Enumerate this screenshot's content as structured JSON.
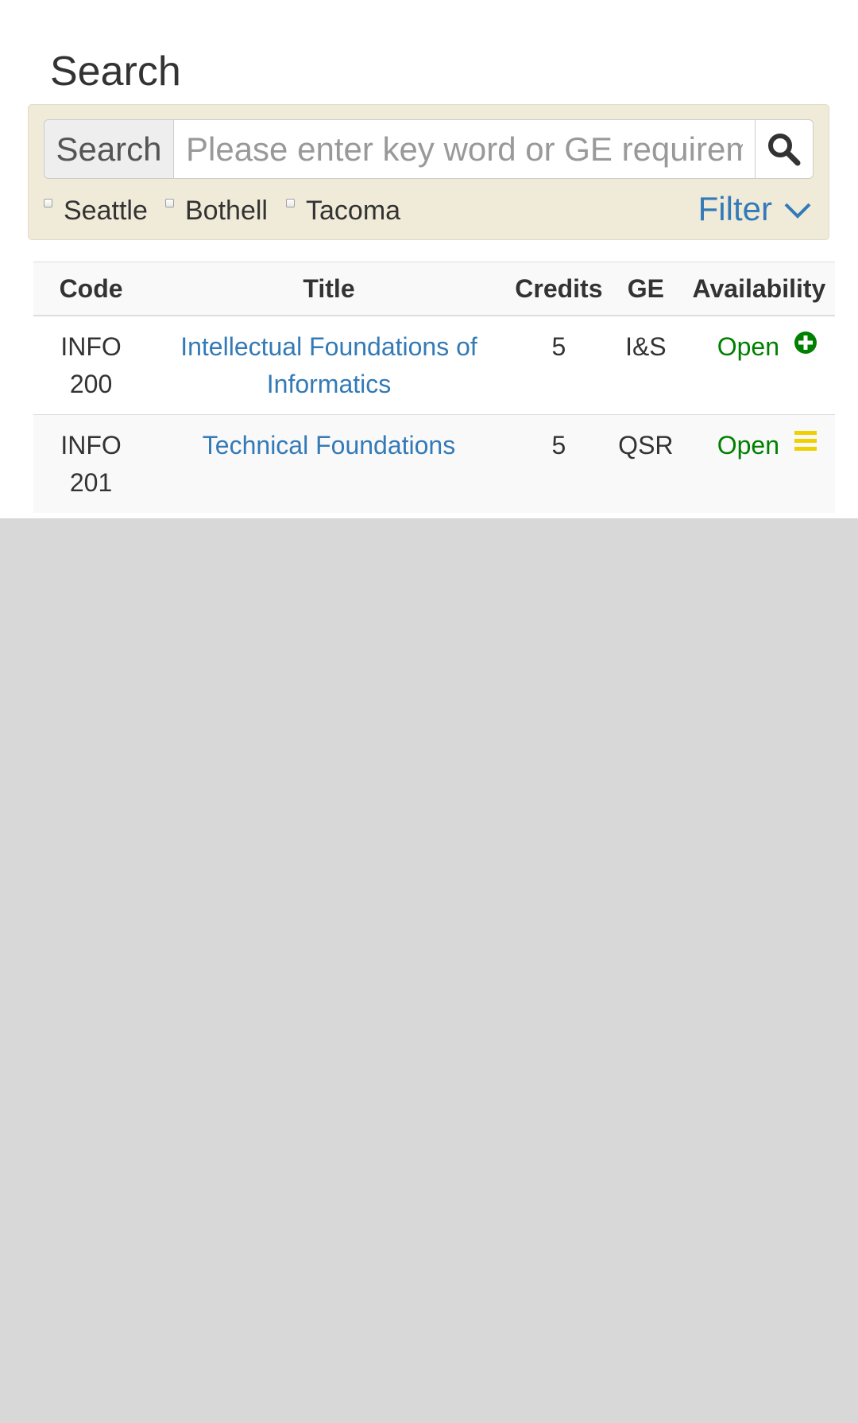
{
  "page": {
    "title": "Search"
  },
  "search": {
    "addon_label": "Search",
    "placeholder": "Please enter key word or GE requirement",
    "value": "",
    "button_icon": "search-icon"
  },
  "campuses": [
    {
      "label": "Seattle",
      "checked": false
    },
    {
      "label": "Bothell",
      "checked": false
    },
    {
      "label": "Tacoma",
      "checked": false
    }
  ],
  "filter": {
    "label": "Filter",
    "icon": "chevron-down-icon"
  },
  "table": {
    "headers": [
      "Code",
      "Title",
      "Credits",
      "GE",
      "Availability"
    ],
    "rows": [
      {
        "code_dept": "INFO",
        "code_num": "200",
        "title": "Intellectual Foundations of Informatics",
        "credits": "5",
        "ge": "I&S",
        "availability": "Open",
        "action_icon": "plus-circle-icon"
      },
      {
        "code_dept": "INFO",
        "code_num": "201",
        "title": "Technical Foundations",
        "credits": "5",
        "ge": "QSR",
        "availability": "Open",
        "action_icon": "list-icon"
      }
    ]
  },
  "colors": {
    "link": "#337ab7",
    "open": "#008000",
    "add_icon": "#008000",
    "list_icon": "#f0d000",
    "well_bg": "#f0ebd9",
    "page_bg": "#d8d8d8"
  }
}
